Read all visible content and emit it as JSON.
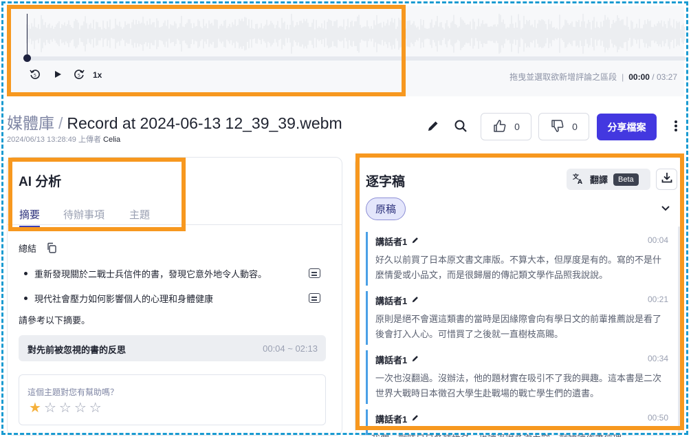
{
  "player": {
    "speed": "1x",
    "hint": "拖曳並選取欲新增評論之區段",
    "separator": "|",
    "current_time": "00:00",
    "slash": "/",
    "duration": "03:27",
    "progress": 0
  },
  "header": {
    "breadcrumb": "媒體庫",
    "slash": "/",
    "title": "Record at 2024-06-13 12_39_39.webm",
    "meta": "2024/06/13 13:28:49 上傳者",
    "uploader": "Celia",
    "like_count": "0",
    "dislike_count": "0",
    "share_label": "分享檔案"
  },
  "analysis": {
    "title": "AI 分析",
    "tabs": [
      "摘要",
      "待辦事項",
      "主題"
    ],
    "summary_label": "總結",
    "bullets": [
      "重新發現關於二戰士兵信件的書，發現它意外地令人動容。",
      "現代社會壓力如何影響個人的心理和身體健康"
    ],
    "note": "請參考以下摘要。",
    "topic": {
      "title": "對先前被忽視的書的反思",
      "range": "00:04 ~ 02:13"
    },
    "feedback": {
      "question": "這個主題對您有幫助嗎？",
      "rating": 1,
      "max": 5
    }
  },
  "transcript": {
    "title": "逐字稿",
    "translate_label": "翻譯",
    "beta_label": "Beta",
    "original_label": "原稿",
    "segments": [
      {
        "speaker": "講話者1",
        "time": "00:04",
        "text": "好久以前買了日本原文書文庫版。不算大本，但厚度是有的。寫的不是什麼情愛或小品文，而是很歸層的傳記類文學作品照我說說。"
      },
      {
        "speaker": "講話者1",
        "time": "00:21",
        "text": "原則是絕不會選這類書的當時是因緣際會向有學日文的前輩推薦說是看了後會打入人心。可惜買了之後就一直樹枝高賜。"
      },
      {
        "speaker": "講話者1",
        "time": "00:34",
        "text": "一次也沒翻過。沒辦法，他的題材實在吸引不了我的興趣。這本書是二次世界大戰時日本徵召大學生赴戰場的戰亡學生們的遺書。"
      },
      {
        "speaker": "講話者1",
        "time": "00:50",
        "text": "我們一戰時日日各種姓名，也讀過很多次內容，就被讀作書信理"
      }
    ]
  },
  "colors": {
    "accent": "#4338e0",
    "highlight": "#f7981f",
    "frame": "#1a9bd1",
    "segment_bar": "#4aa0e6",
    "star": "#f5b03a"
  }
}
